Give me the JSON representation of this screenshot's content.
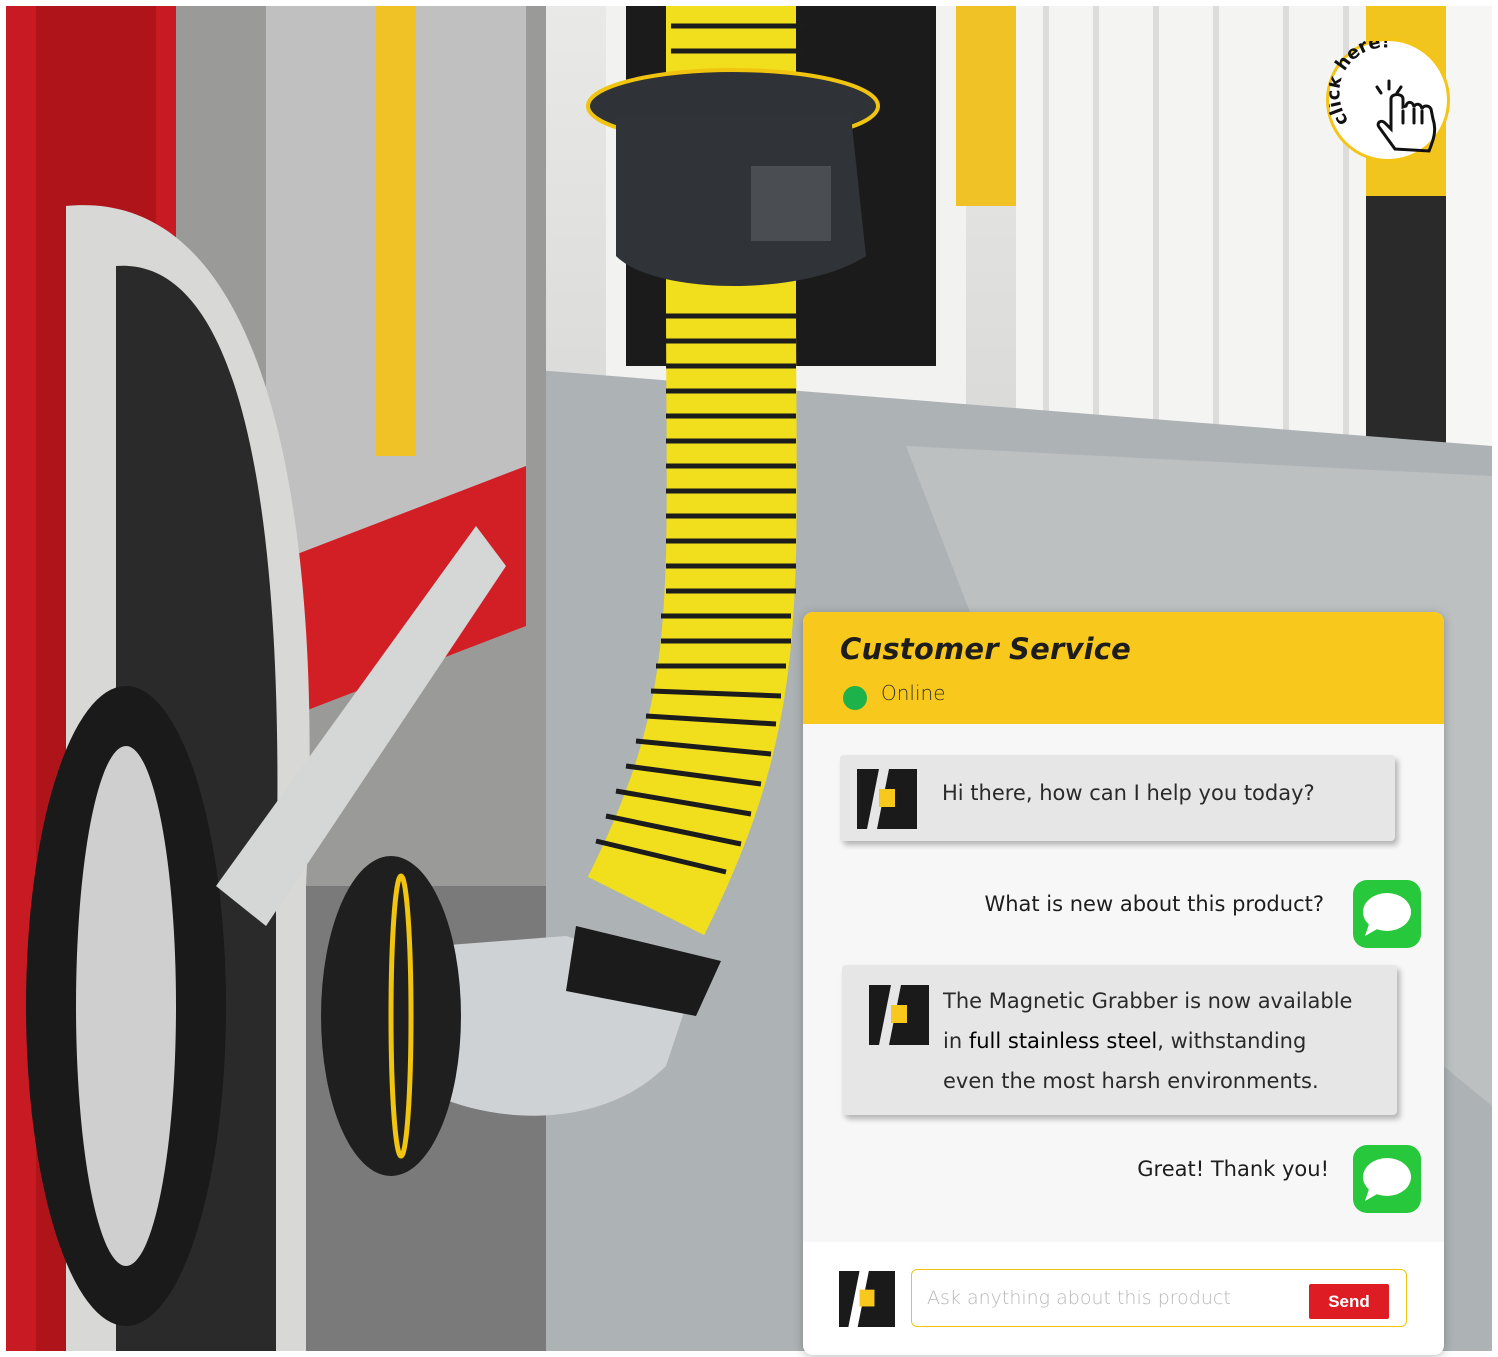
{
  "badge": {
    "label": "click here!",
    "icon": "pointing-hand-icon"
  },
  "chat": {
    "title": "Customer Service",
    "status": "Online",
    "status_color": "#1db24a",
    "header_color": "#f8c81c",
    "messages": [
      {
        "from": "agent",
        "text": "Hi there, how can I help you today?"
      },
      {
        "from": "user",
        "text": "What is new about this product?"
      },
      {
        "from": "agent",
        "lines": [
          "The Magnetic Grabber is now available",
          "withstanding",
          "even the most harsh environments."
        ],
        "prefix": "in ",
        "highlight": "full stainless steel",
        "suffix": ", withstanding"
      },
      {
        "from": "user",
        "text": "Great! Thank you!"
      }
    ],
    "input": {
      "placeholder": "Ask anything about this product",
      "value": ""
    },
    "send_label": "Send",
    "send_color": "#dd1c24"
  }
}
